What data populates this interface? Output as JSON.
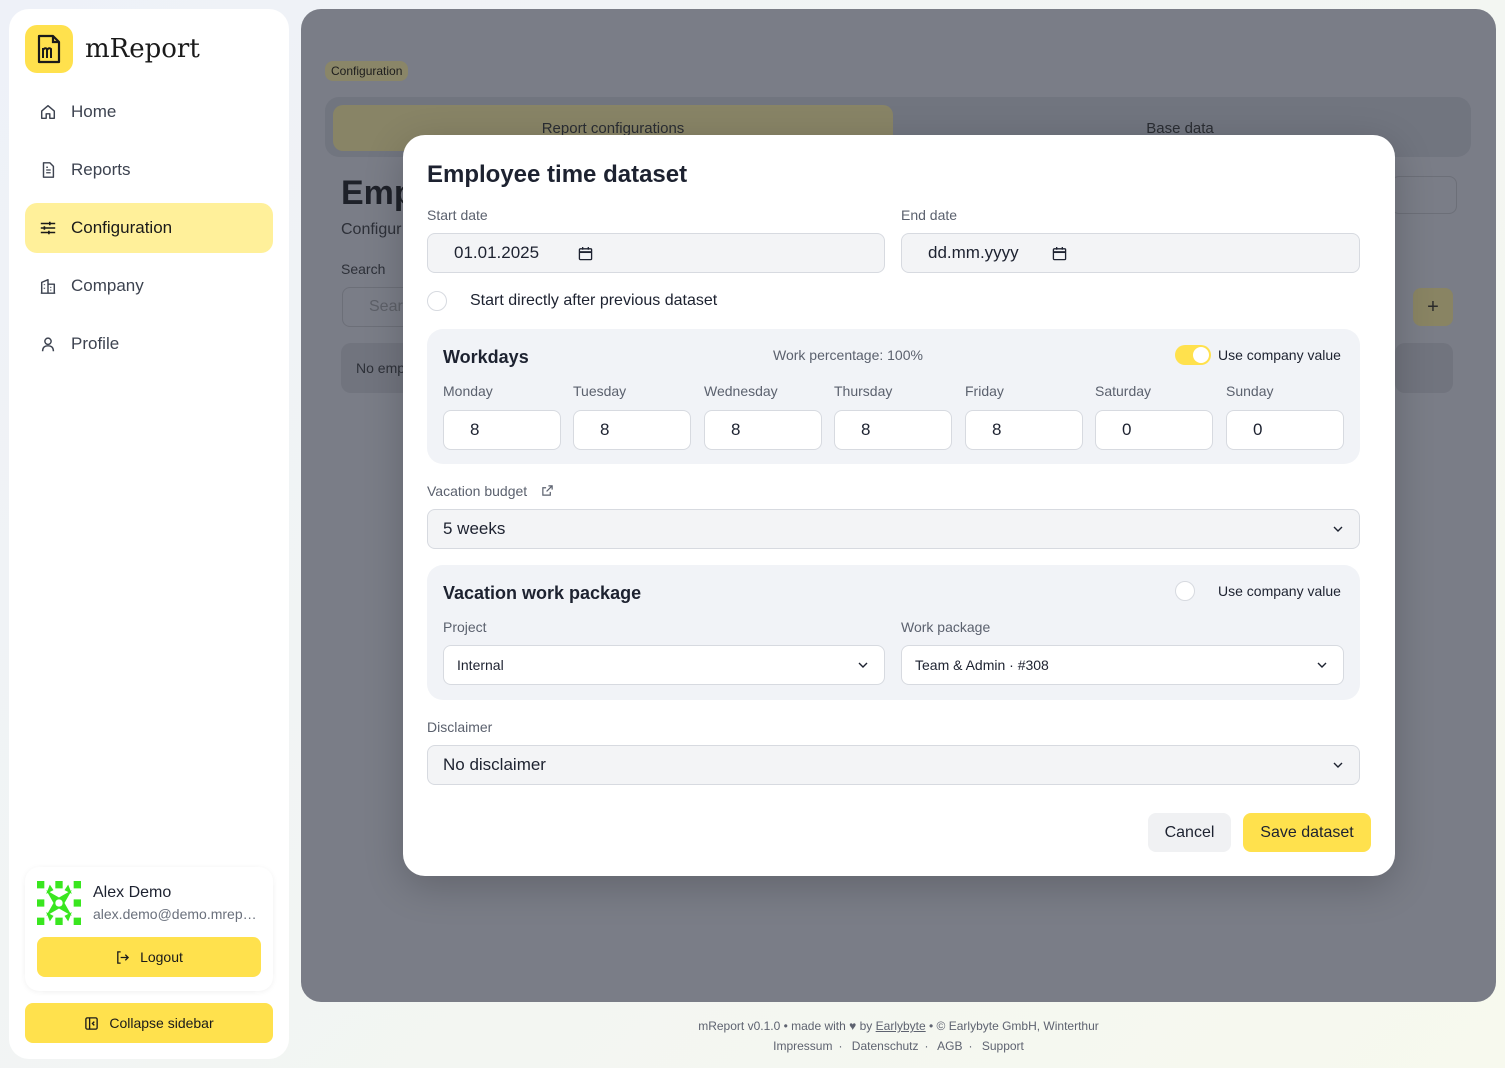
{
  "brand": {
    "name": "mReport",
    "logo_letter": "m"
  },
  "sidebar": {
    "items": [
      {
        "label": "Home",
        "icon": "home-icon"
      },
      {
        "label": "Reports",
        "icon": "document-icon"
      },
      {
        "label": "Configuration",
        "icon": "sliders-icon",
        "active": true
      },
      {
        "label": "Company",
        "icon": "building-icon"
      },
      {
        "label": "Profile",
        "icon": "user-icon"
      }
    ],
    "user": {
      "name": "Alex Demo",
      "email": "alex.demo@demo.mreport.ch"
    },
    "logout_label": "Logout",
    "collapse_label": "Collapse sidebar"
  },
  "background": {
    "breadcrumb": "Configuration",
    "tabs": [
      "Report configurations",
      "Base data"
    ],
    "title": "Emp",
    "subtitle": "Configur",
    "search_label": "Search",
    "search_placeholder": "Sear",
    "empty_text": "No emp",
    "add_label": "+"
  },
  "modal": {
    "title": "Employee time dataset",
    "start_date_label": "Start date",
    "start_date_value": "01.01.2025",
    "end_date_label": "End date",
    "end_date_value": "dd.mm.yyyy",
    "start_after_previous_label": "Start directly after previous dataset",
    "workdays": {
      "title": "Workdays",
      "work_percentage": "Work percentage: 100%",
      "use_company_value_label": "Use company value",
      "use_company_value": true,
      "days": [
        {
          "label": "Monday",
          "value": "8"
        },
        {
          "label": "Tuesday",
          "value": "8"
        },
        {
          "label": "Wednesday",
          "value": "8"
        },
        {
          "label": "Thursday",
          "value": "8"
        },
        {
          "label": "Friday",
          "value": "8"
        },
        {
          "label": "Saturday",
          "value": "0"
        },
        {
          "label": "Sunday",
          "value": "0"
        }
      ]
    },
    "vacation_budget_label": "Vacation budget",
    "vacation_budget_value": "5 weeks",
    "vacation_package": {
      "title": "Vacation work package",
      "use_company_value_label": "Use company value",
      "use_company_value": false,
      "project_label": "Project",
      "project_value": "Internal",
      "work_package_label": "Work package",
      "work_package_value": "Team & Admin · #308"
    },
    "disclaimer_label": "Disclaimer",
    "disclaimer_value": "No disclaimer",
    "cancel_label": "Cancel",
    "save_label": "Save dataset"
  },
  "footer": {
    "line1_prefix": "mReport v0.1.0 • made with ♥ by",
    "line1_link": "Earlybyte",
    "line1_suffix": "• © Earlybyte GmbH, Winterthur",
    "links": [
      "Impressum",
      "Datenschutz",
      "AGB",
      "Support"
    ]
  },
  "colors": {
    "accent": "#ffe14d",
    "active_nav": "#fff09a",
    "avatar": "#39e61f"
  }
}
